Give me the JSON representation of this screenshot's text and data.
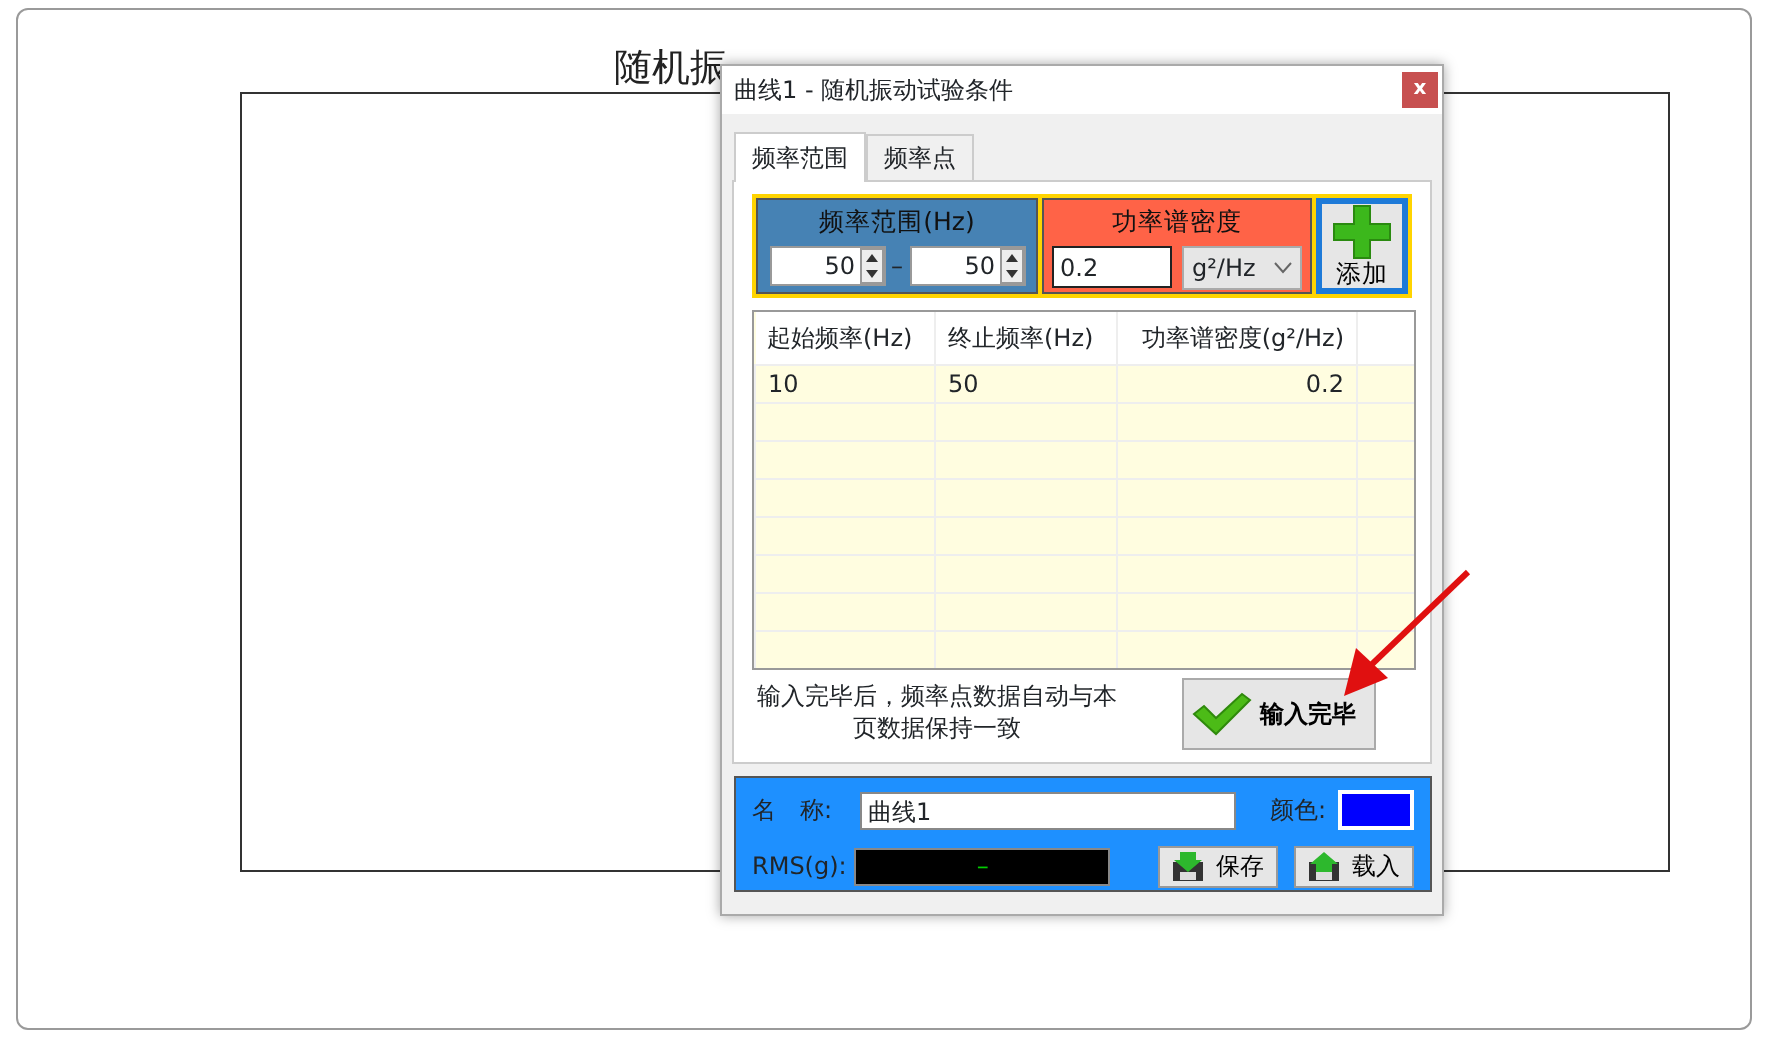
{
  "main_window": {
    "chart_title": "随机振"
  },
  "dialog": {
    "title": "曲线1 - 随机振动试验条件",
    "close": "x"
  },
  "tabs": [
    {
      "label": "频率范围",
      "selected": true
    },
    {
      "label": "频率点",
      "selected": false
    }
  ],
  "range": {
    "label": "频率范围(Hz)",
    "from": "50",
    "separator": "–",
    "to": "50"
  },
  "psd": {
    "label": "功率谱密度",
    "value": "0.2",
    "unit": "g²/Hz"
  },
  "add_button": "添加",
  "table": {
    "columns": [
      "起始频率(Hz)",
      "终止频率(Hz)",
      "功率谱密度(g²/Hz)"
    ],
    "rows": [
      [
        "10",
        "50",
        "0.2"
      ]
    ]
  },
  "note": "输入完毕后，频率点数据自动与本页数据保持一致",
  "done_button": "输入完毕",
  "curve": {
    "name_label": "名　称:",
    "name": "曲线1",
    "color_label": "颜色:",
    "color": "#0000ff",
    "rms_label": "RMS(g):",
    "rms": "–"
  },
  "save_button": "保存",
  "load_button": "载入"
}
